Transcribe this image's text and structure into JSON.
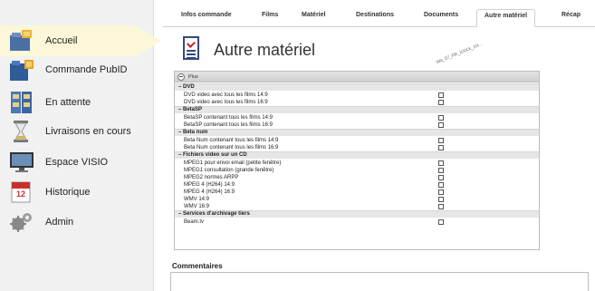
{
  "sidebar": {
    "items": [
      {
        "label": "Accueil",
        "icon": "home-folder-icon"
      },
      {
        "label": "Commande PubID",
        "icon": "order-folder-icon"
      },
      {
        "label": "En attente",
        "icon": "cabinet-icon"
      },
      {
        "label": "Livraisons en cours",
        "icon": "hourglass-icon"
      },
      {
        "label": "Espace VISIO",
        "icon": "monitor-icon"
      },
      {
        "label": "Historique",
        "icon": "calendar-icon"
      },
      {
        "label": "Admin",
        "icon": "gears-icon"
      }
    ],
    "calendar_badge": "12"
  },
  "tabs": [
    "Infos commande",
    "Films",
    "Matériel",
    "Destinations",
    "Documents",
    "Autre matériel",
    "Récap"
  ],
  "page": {
    "title": "Autre matériel",
    "stamp": "Wa_07_FR_XXXX_XX..."
  },
  "panel": {
    "title": "Plus",
    "sections": [
      {
        "title": "DVD",
        "items": [
          "DVD video avec tous les films 14:9",
          "DVD video avec tous les films 16:9"
        ]
      },
      {
        "title": "BetaSP",
        "items": [
          "BetaSP contenant tous les films 14:9",
          "BetaSP contenant tous les films 16:9"
        ]
      },
      {
        "title": "Beta num",
        "items": [
          "Beta Num contenant tous les films 14:9",
          "Beta Num contenant tous les films 16:9"
        ]
      },
      {
        "title": "Fichiers video sur un CD",
        "items": [
          "MPEG1 pour envoi email (petite fenêtre)",
          "MPEG1 consultation (grande fenêtre)",
          "MPEG2 normes ARPP",
          "MPEG 4 (H264) 14:9",
          "MPEG 4 (H264) 16:9",
          "WMV 14:9",
          "WMV 16:9"
        ]
      },
      {
        "title": "Services d'archivage tiers",
        "items": [
          "Beam.tv"
        ]
      }
    ]
  },
  "comments": {
    "label": "Commentaires",
    "value": ""
  }
}
